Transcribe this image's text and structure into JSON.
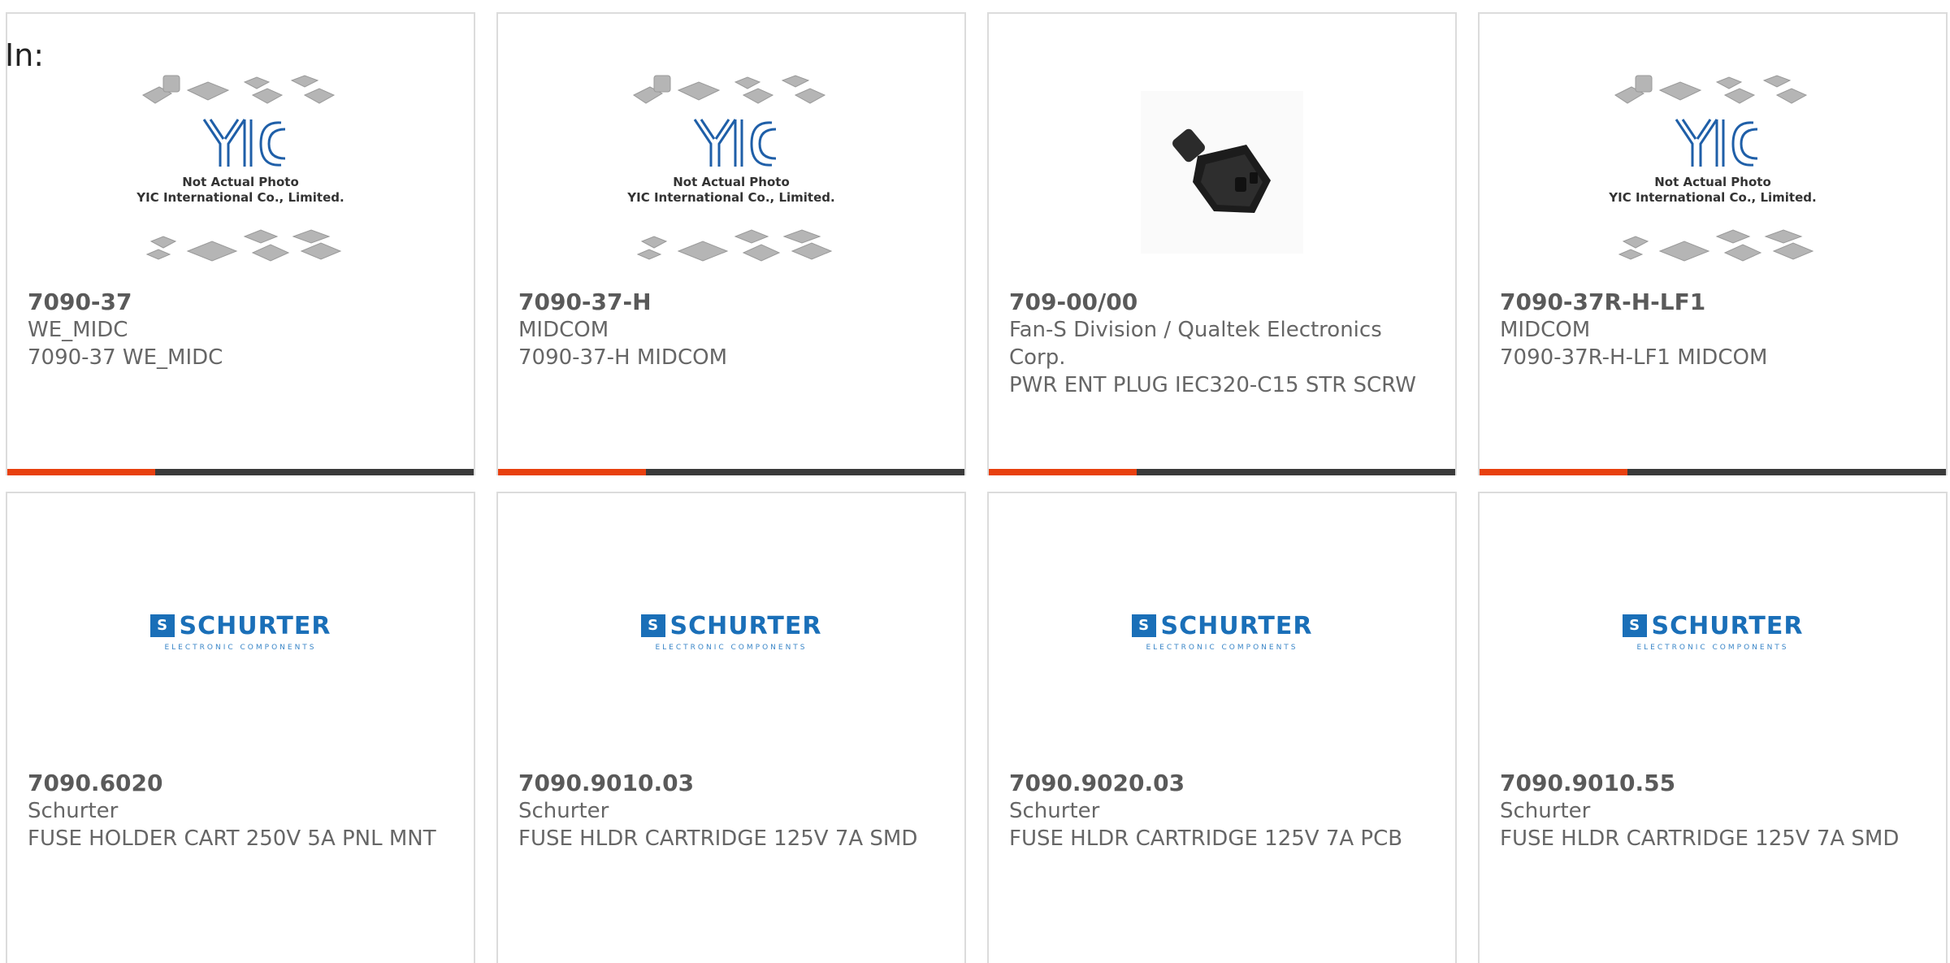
{
  "header": {
    "in_label": "In:"
  },
  "images": {
    "yic_line1": "Not Actual Photo",
    "yic_line2": "YIC International Co., Limited.",
    "schurter_word": "SCHURTER",
    "schurter_box": "S",
    "schurter_sub": "ELECTRONIC COMPONENTS"
  },
  "products": [
    {
      "part": "7090-37",
      "mfr": "WE_MIDC",
      "desc": "7090-37 WE_MIDC",
      "image": "yic-placeholder"
    },
    {
      "part": "7090-37-H",
      "mfr": "MIDCOM",
      "desc": "7090-37-H MIDCOM",
      "image": "yic-placeholder"
    },
    {
      "part": "709-00/00",
      "mfr": "Fan-S Division / Qualtek Electronics Corp.",
      "desc": "PWR ENT PLUG IEC320-C15 STR SCRW",
      "image": "power-plug-photo"
    },
    {
      "part": "7090-37R-H-LF1",
      "mfr": "MIDCOM",
      "desc": "7090-37R-H-LF1 MIDCOM",
      "image": "yic-placeholder"
    },
    {
      "part": "7090.6020",
      "mfr": "Schurter",
      "desc": "FUSE HOLDER CART 250V 5A PNL MNT",
      "image": "schurter-logo"
    },
    {
      "part": "7090.9010.03",
      "mfr": "Schurter",
      "desc": "FUSE HLDR CARTRIDGE 125V 7A SMD",
      "image": "schurter-logo"
    },
    {
      "part": "7090.9020.03",
      "mfr": "Schurter",
      "desc": "FUSE HLDR CARTRIDGE 125V 7A PCB",
      "image": "schurter-logo"
    },
    {
      "part": "7090.9010.55",
      "mfr": "Schurter",
      "desc": "FUSE HLDR CARTRIDGE 125V 7A SMD",
      "image": "schurter-logo"
    }
  ],
  "colors": {
    "accent": "#e8400f",
    "bar": "#3a3a3a",
    "schurter_blue": "#1a6fb8",
    "yic_blue": "#1f5fa8"
  }
}
